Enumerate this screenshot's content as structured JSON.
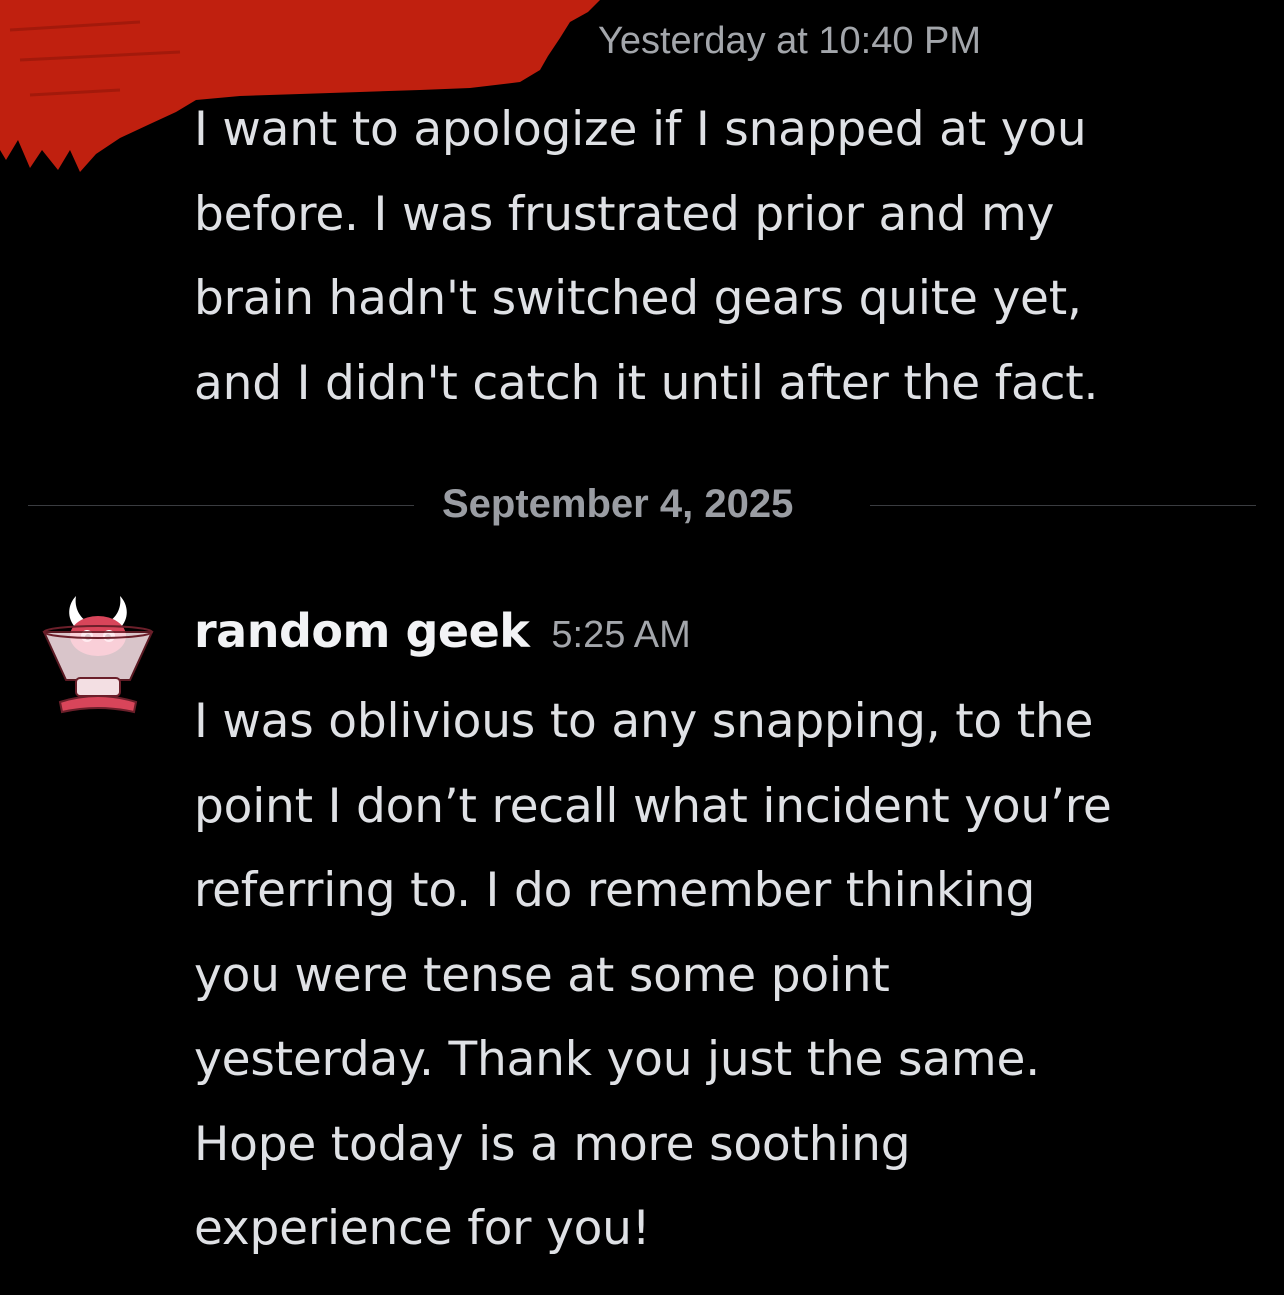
{
  "messages": [
    {
      "timestamp": "Yesterday at 10:40 PM",
      "lines": [
        "I want to apologize if I snapped at you",
        "before. I was frustrated prior and my",
        "brain hadn't switched gears quite yet,",
        "and I didn't catch it until after the fact."
      ]
    },
    {
      "author": "random geek",
      "timestamp": "5:25 AM",
      "lines": [
        "I was oblivious to any snapping, to the",
        "point I don’t recall what incident you’re",
        "referring to. I do remember thinking",
        "you were tense at some point",
        "yesterday. Thank you just the same.",
        "Hope today is a more soothing",
        "experience for you!"
      ]
    }
  ],
  "date_divider": "September 4, 2025",
  "colors": {
    "background": "#000000",
    "redaction": "#c0200f",
    "text": "#dfe1e5",
    "muted": "#a3a6ab"
  },
  "icons": {
    "avatar": "devil-cone-avatar-icon"
  }
}
